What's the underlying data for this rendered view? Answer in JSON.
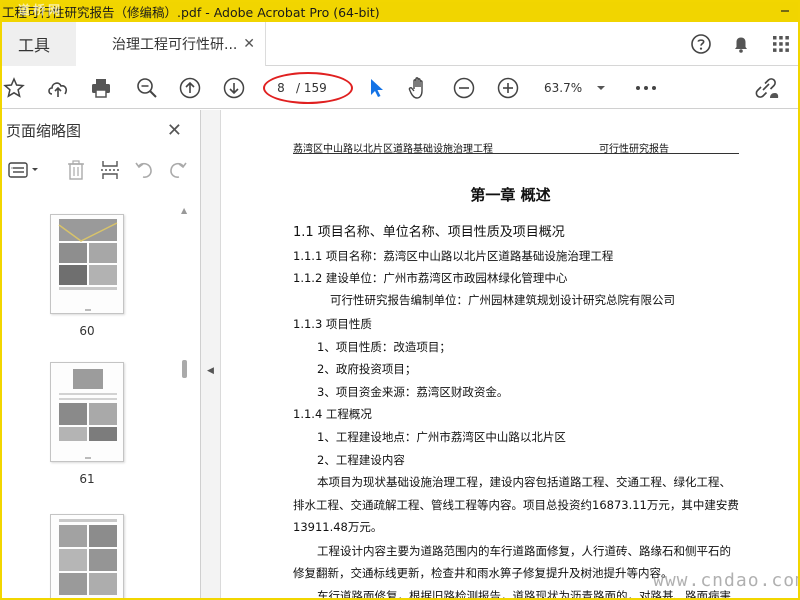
{
  "window": {
    "title": "工程可行性研究报告（修编稿）.pdf - Adobe Acrobat Pro (64-bit)",
    "watermark_top": "道桥网"
  },
  "tabs": {
    "tools_label": "工具",
    "document_tab_label": "治理工程可行性研...",
    "close_glyph": "✕"
  },
  "toolbar": {
    "current_page": "8",
    "total_pages": "/ 159",
    "zoom_level": "63.7%"
  },
  "sidebar": {
    "title": "页面缩略图",
    "thumbnails": [
      {
        "page_label": "60"
      },
      {
        "page_label": "61"
      },
      {
        "page_label": ""
      }
    ]
  },
  "document": {
    "header_left": "荔湾区中山路以北片区道路基础设施治理工程",
    "header_right": "可行性研究报告",
    "chapter_title": "第一章  概述",
    "section_1_1": "1.1  项目名称、单位名称、项目性质及项目概况",
    "line_1_1_1": "1.1.1  项目名称：荔湾区中山路以北片区道路基础设施治理工程",
    "line_1_1_2": "1.1.2  建设单位：广州市荔湾区市政园林绿化管理中心",
    "line_compiler": "可行性研究报告编制单位：广州园林建筑规划设计研究总院有限公司",
    "line_1_1_3": "1.1.3  项目性质",
    "line_nature_1": "1、项目性质：改造项目；",
    "line_nature_2": "2、政府投资项目；",
    "line_nature_3": "3、项目资金来源：荔湾区财政资金。",
    "line_1_1_4": "1.1.4  工程概况",
    "line_overview_1": "1、工程建设地点：广州市荔湾区中山路以北片区",
    "line_overview_2": "2、工程建设内容",
    "para_1_a": "本项目为现状基础设施治理工程，建设内容包括道路工程、交通工程、绿化工程、",
    "para_1_b": "排水工程、交通疏解工程、管线工程等内容。项目总投资约16873.11万元，其中建安费",
    "para_1_c": "13911.48万元。",
    "para_2_a": "工程设计内容主要为道路范围内的车行道路面修复，人行道砖、路缘石和侧平石的",
    "para_2_b": "修复翻新，交通标线更新，检查井和雨水箅子修复提升及树池提升等内容。",
    "para_3_a": "车行道路面修复，根据旧路检测报告，道路现状为沥青路面的，对路基、路面病害"
  },
  "footer": {
    "watermark": "www.cndao.com"
  },
  "colors": {
    "titlebar_yellow": "#f1d500",
    "acrobat_blue": "#1473e6",
    "highlight_red": "#e02020"
  }
}
